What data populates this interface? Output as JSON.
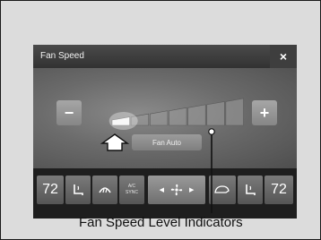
{
  "screen": {
    "title": "Fan Speed",
    "close_label": "×",
    "minus_label": "−",
    "plus_label": "+",
    "mode_button_label": "Fan Auto"
  },
  "fan_speed": {
    "levels_total": 7,
    "levels_lit": 1
  },
  "bottom_bar": {
    "driver_temp": "72",
    "passenger_temp": "72",
    "ac_label": "A/C",
    "sync_label": "SYNC",
    "left_arrow": "◀",
    "right_arrow": "▶"
  },
  "callout": {
    "label": "Fan Speed Level Indicators"
  }
}
